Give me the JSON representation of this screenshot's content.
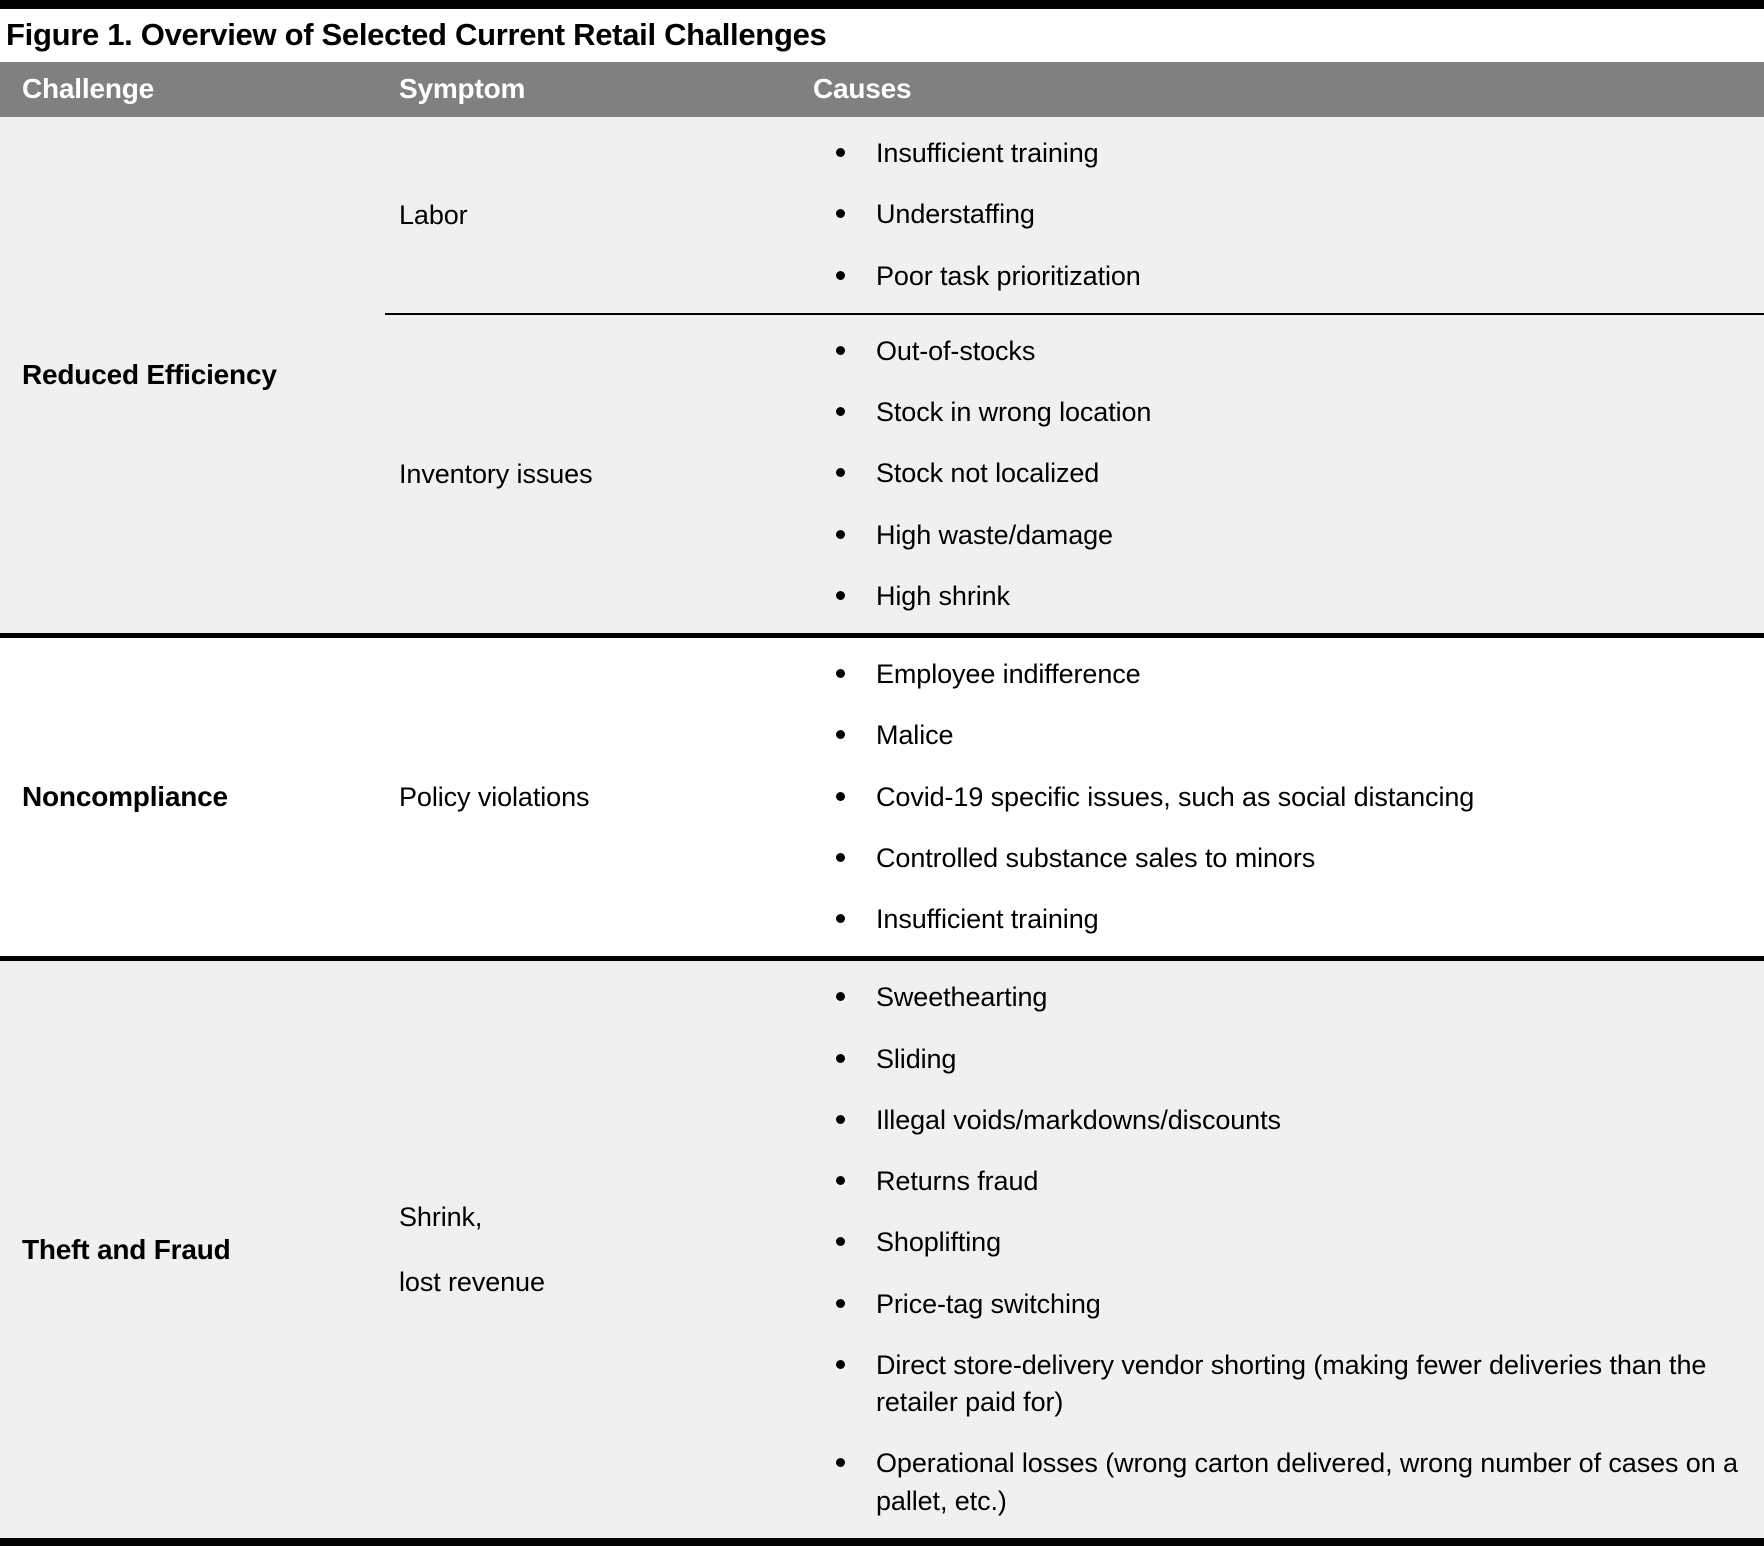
{
  "figure": {
    "title": "Figure 1. Overview of Selected Current Retail Challenges"
  },
  "table": {
    "columns": {
      "challenge": "Challenge",
      "symptom": "Symptom",
      "causes": "Causes"
    },
    "sections": [
      {
        "challenge": "Reduced Efficiency",
        "shaded": true,
        "rows": [
          {
            "symptom_lines": [
              "Labor"
            ],
            "causes": [
              "Insufficient training",
              "Understaffing",
              "Poor task prioritization"
            ]
          },
          {
            "symptom_lines": [
              "Inventory issues"
            ],
            "causes": [
              "Out-of-stocks",
              "Stock in wrong location",
              "Stock not localized",
              "High waste/damage",
              "High shrink"
            ]
          }
        ]
      },
      {
        "challenge": "Noncompliance",
        "shaded": false,
        "rows": [
          {
            "symptom_lines": [
              "Policy violations"
            ],
            "causes": [
              "Employee indifference",
              "Malice",
              "Covid-19 specific issues, such as social distancing",
              "Controlled substance sales to minors",
              "Insufficient training"
            ]
          }
        ]
      },
      {
        "challenge": "Theft and Fraud",
        "shaded": true,
        "rows": [
          {
            "symptom_lines": [
              "Shrink,",
              "lost revenue"
            ],
            "causes": [
              "Sweethearting",
              "Sliding",
              "Illegal voids/markdowns/discounts",
              "Returns fraud",
              "Shoplifting",
              "Price-tag switching",
              "Direct store-delivery vendor shorting (making fewer deliveries than the retailer paid for)",
              "Operational losses (wrong carton delivered, wrong number of cases on a pallet, etc.)"
            ]
          }
        ]
      }
    ]
  },
  "colors": {
    "header_background": "#808080",
    "header_text": "#FFFFFF",
    "shaded_row": "#F0F0F0",
    "plain_row": "#FFFFFF",
    "rule": "#000000"
  }
}
